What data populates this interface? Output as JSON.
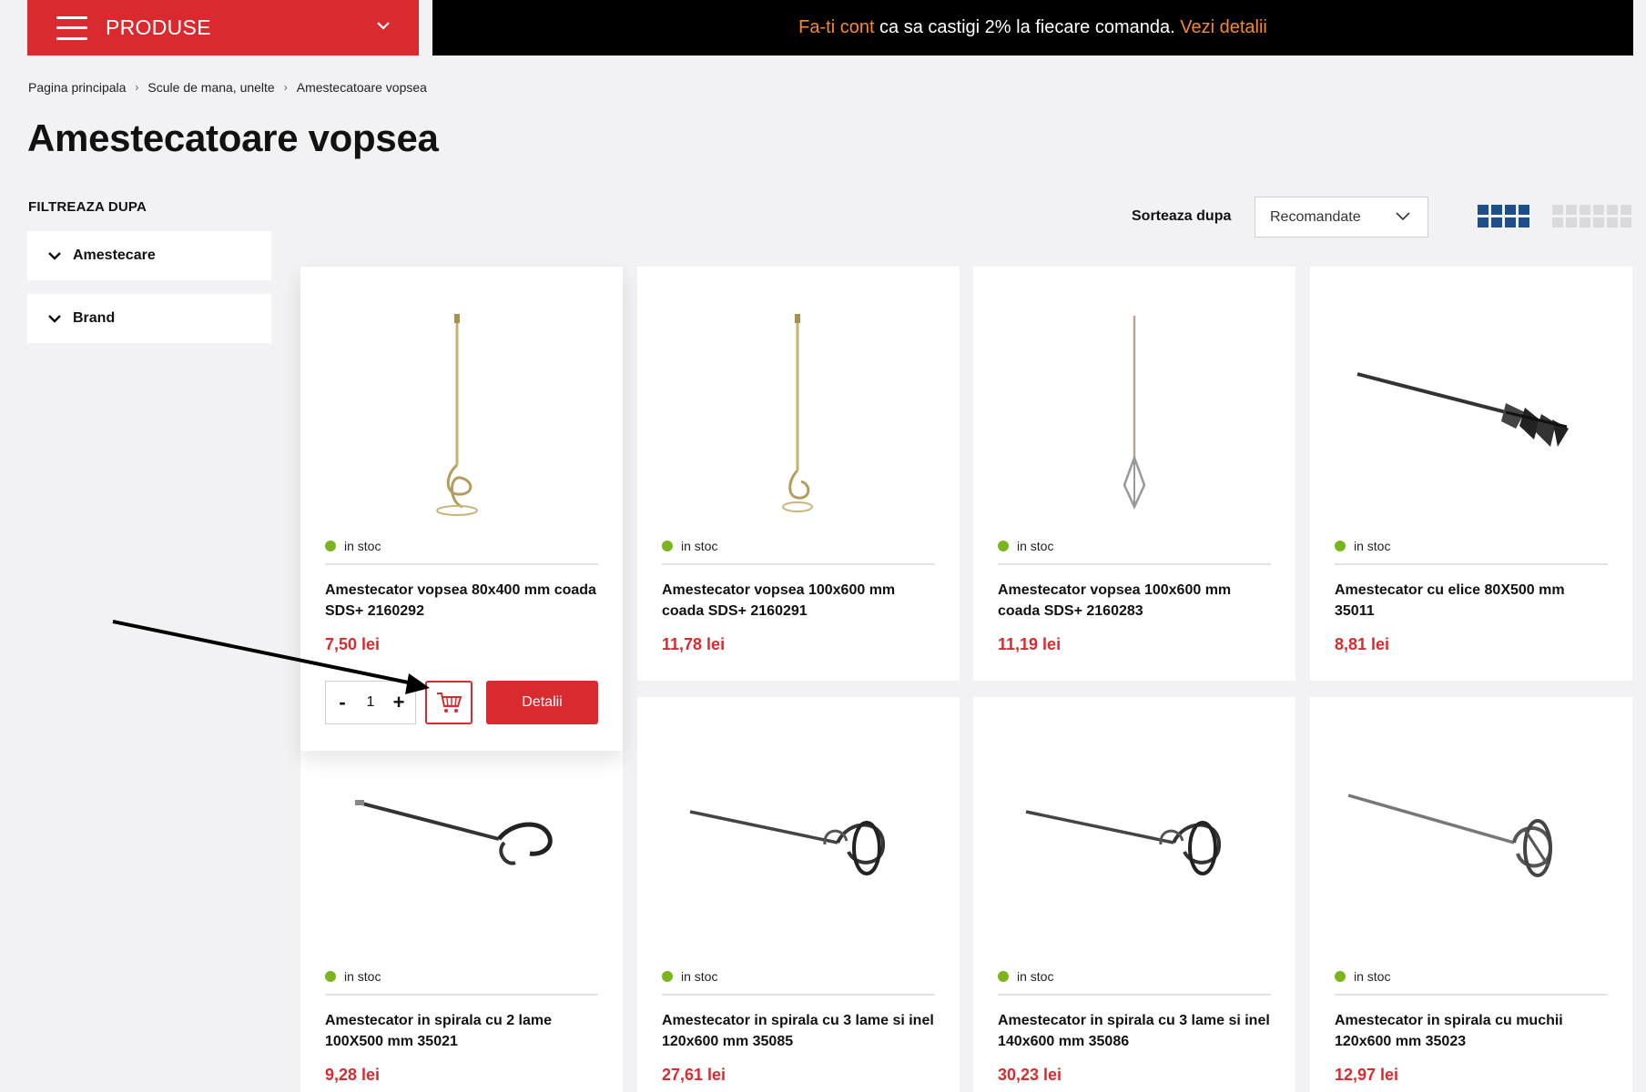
{
  "header": {
    "menu_label": "PRODUSE",
    "promo": {
      "link1": "Fa-ti cont",
      "text": " ca sa castigi 2% la fiecare comanda. ",
      "link2": "Vezi detalii"
    }
  },
  "breadcrumb": [
    "Pagina principala",
    "Scule de mana, unelte",
    "Amestecatoare vopsea"
  ],
  "page_title": "Amestecatoare vopsea",
  "filters": {
    "title": "FILTREAZA DUPA",
    "items": [
      "Amestecare",
      "Brand"
    ]
  },
  "sort": {
    "label": "Sorteaza dupa",
    "selected": "Recomandate"
  },
  "products": [
    {
      "stock": "in stoc",
      "name": "Amestecator vopsea 80x400 mm coada SDS+ 2160292",
      "price": "7,50 lei",
      "qty": "1",
      "details_label": "Detalii"
    },
    {
      "stock": "in stoc",
      "name": "Amestecator vopsea 100x600 mm coada SDS+ 2160291",
      "price": "11,78 lei"
    },
    {
      "stock": "in stoc",
      "name": "Amestecator vopsea 100x600 mm coada SDS+ 2160283",
      "price": "11,19 lei"
    },
    {
      "stock": "in stoc",
      "name": "Amestecator cu elice 80X500 mm 35011",
      "price": "8,81 lei"
    },
    {
      "stock": "in stoc",
      "name": "Amestecator in spirala cu 2 lame 100X500 mm 35021",
      "price": "9,28 lei"
    },
    {
      "stock": "in stoc",
      "name": "Amestecator in spirala cu 3 lame si inel 120x600 mm 35085",
      "price": "27,61 lei"
    },
    {
      "stock": "in stoc",
      "name": "Amestecator in spirala cu 3 lame si inel 140x600 mm 35086",
      "price": "30,23 lei"
    },
    {
      "stock": "in stoc",
      "name": "Amestecator in spirala cu muchii 120x600 mm 35023",
      "price": "12,97 lei"
    }
  ],
  "colors": {
    "brand_red": "#d92b2f",
    "promo_orange": "#f7882f",
    "stock_green": "#7ab51d",
    "view_active": "#1d4f8c"
  }
}
